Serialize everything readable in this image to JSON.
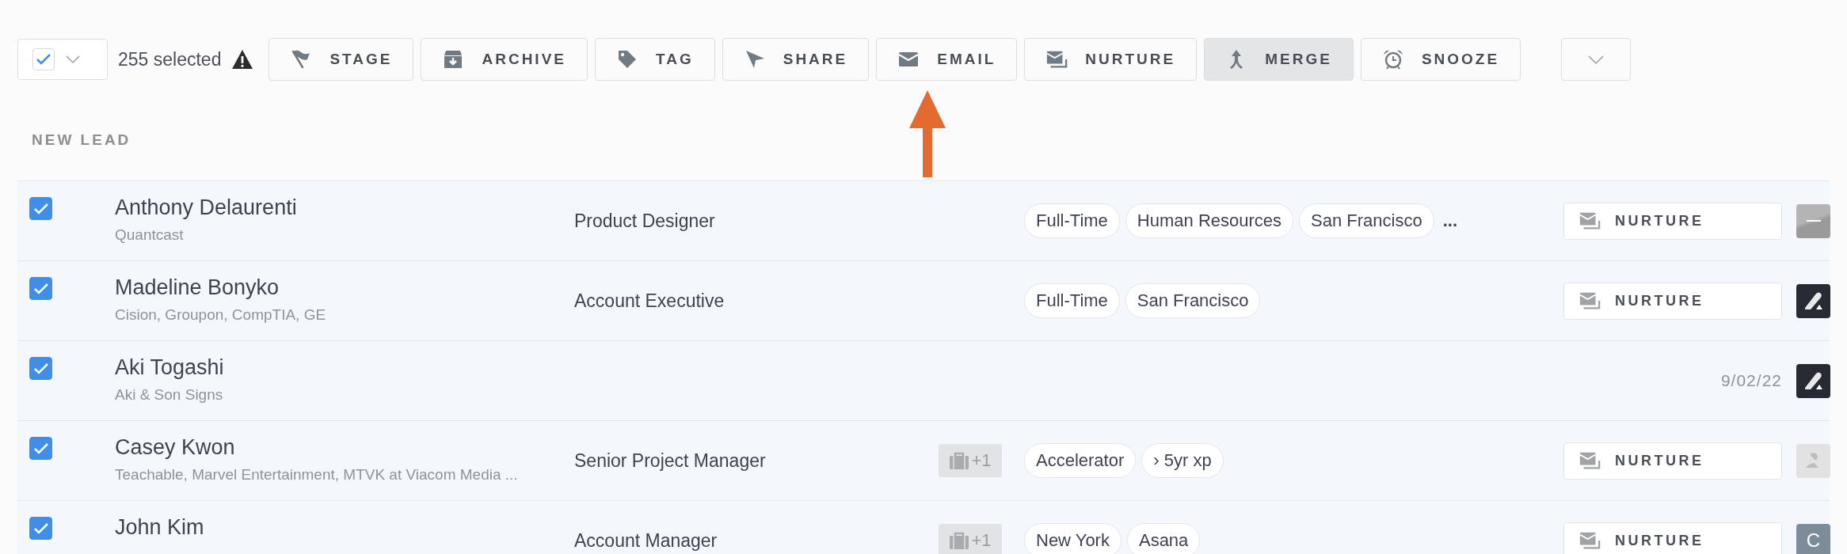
{
  "toolbar": {
    "select_all": {
      "checked": true
    },
    "count": "255 selected",
    "actions": [
      {
        "label": "STAGE",
        "selected": false
      },
      {
        "label": "ARCHIVE",
        "selected": false
      },
      {
        "label": "TAG",
        "selected": false
      },
      {
        "label": "SHARE",
        "selected": false
      },
      {
        "label": "EMAIL",
        "selected": false
      },
      {
        "label": "NURTURE",
        "selected": false
      },
      {
        "label": "MERGE",
        "selected": true
      },
      {
        "label": "SNOOZE",
        "selected": false
      }
    ]
  },
  "section": {
    "title": "NEW LEAD"
  },
  "rows": [
    {
      "checked": true,
      "name": "Anthony Delaurenti",
      "company": "Quantcast",
      "title": "Product Designer",
      "tags": [
        "Full-Time",
        "Human Resources",
        "San Francisco"
      ],
      "tags_more": "...",
      "action": {
        "kind": "button",
        "label": "NURTURE"
      },
      "avatar": {
        "kind": "blank"
      }
    },
    {
      "checked": true,
      "name": "Madeline Bonyko",
      "company": "Cision, Groupon, CompTIA, GE",
      "title": "Account Executive",
      "tags": [
        "Full-Time",
        "San Francisco"
      ],
      "action": {
        "kind": "button",
        "label": "NURTURE"
      },
      "avatar": {
        "kind": "pen"
      }
    },
    {
      "checked": true,
      "name": "Aki Togashi",
      "company": "Aki & Son Signs",
      "action": {
        "kind": "date",
        "label": "9/02/22"
      },
      "avatar": {
        "kind": "pen"
      }
    },
    {
      "checked": true,
      "name": "Casey Kwon",
      "company": "Teachable, Marvel Entertainment, MTVK at Viacom Media ...",
      "title": "Senior Project Manager",
      "badge": "+1",
      "tags": [
        "Accelerator",
        "› 5yr xp"
      ],
      "action": {
        "kind": "button",
        "label": "NURTURE"
      },
      "avatar": {
        "kind": "muted"
      }
    },
    {
      "checked": true,
      "name": "John Kim",
      "title": "Account Manager",
      "badge": "+1",
      "tags": [
        "New York",
        "Asana"
      ],
      "action": {
        "kind": "button",
        "label": "NURTURE"
      },
      "avatar": {
        "kind": "letter",
        "letter": "C"
      }
    }
  ]
}
